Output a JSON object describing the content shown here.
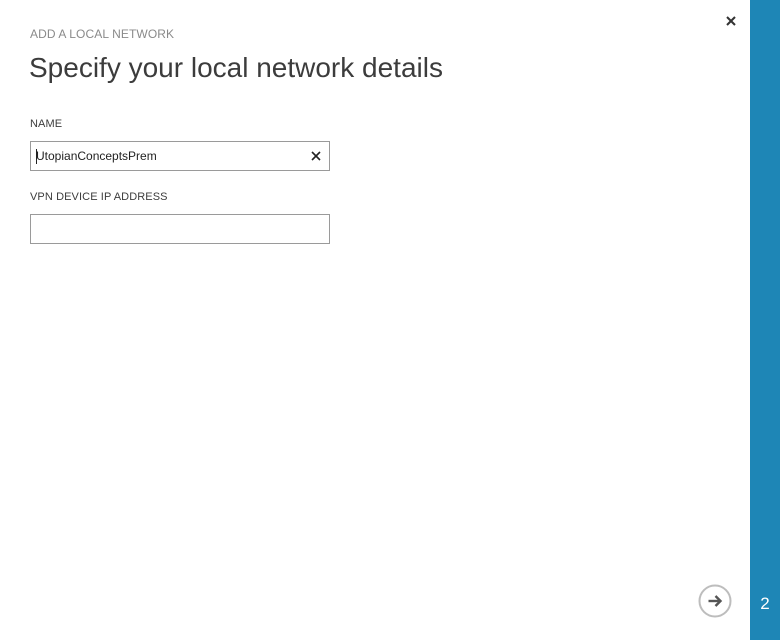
{
  "dialog": {
    "eyebrow": "ADD A LOCAL NETWORK",
    "title": "Specify your local network details",
    "close_icon": "close-icon",
    "next_icon": "arrow-right-circle-icon"
  },
  "form": {
    "name_label": "NAME",
    "name_value": "UtopianConceptsPrem",
    "clear_icon": "clear-icon",
    "ip_label": "VPN DEVICE IP ADDRESS",
    "ip_value": ""
  },
  "wizard": {
    "step": "2",
    "accent_color": "#1e86b6"
  }
}
